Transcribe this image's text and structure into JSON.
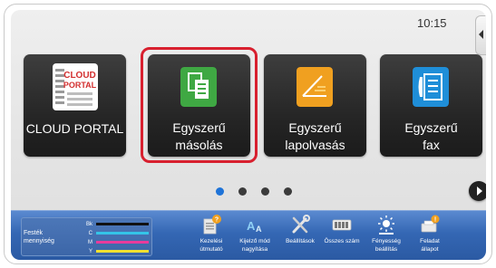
{
  "status": {
    "time": "10:15"
  },
  "tiles": [
    {
      "label": "CLOUD PORTAL",
      "icon": "cloud-portal-logo-icon",
      "logo_text_1": "CLOUD",
      "logo_text_2": "PORTAL"
    },
    {
      "label_line1": "Egyszerű",
      "label_line2": "másolás",
      "icon": "copy-icon",
      "selected": true
    },
    {
      "label_line1": "Egyszerű",
      "label_line2": "lapolvasás",
      "icon": "scan-icon"
    },
    {
      "label_line1": "Egyszerű",
      "label_line2": "fax",
      "icon": "fax-icon"
    }
  ],
  "pagination": {
    "pages": 4,
    "current": 1
  },
  "toner": {
    "title_line1": "Festék",
    "title_line2": "mennyiség",
    "levels": [
      {
        "code": "Bk",
        "color": "#111111"
      },
      {
        "code": "C",
        "color": "#34c4e8"
      },
      {
        "code": "M",
        "color": "#e83b9c"
      },
      {
        "code": "Y",
        "color": "#f0e030"
      }
    ]
  },
  "functions": [
    {
      "line1": "Kezelési",
      "line2": "útmutató",
      "icon": "manual-icon"
    },
    {
      "line1": "Kijelző mód",
      "line2": "nagyítása",
      "icon": "display-zoom-icon"
    },
    {
      "line1": "Beállítások",
      "line2": "",
      "icon": "settings-tools-icon"
    },
    {
      "line1": "Összes szám",
      "line2": "",
      "icon": "counter-icon"
    },
    {
      "line1": "Fényesség",
      "line2": "beállítás",
      "icon": "brightness-icon"
    },
    {
      "line1": "Feladat",
      "line2": "állapot",
      "icon": "job-status-icon"
    }
  ],
  "colors": {
    "highlight": "#d8202f",
    "bar": "#3467b4",
    "active_dot": "#1e73d8"
  }
}
